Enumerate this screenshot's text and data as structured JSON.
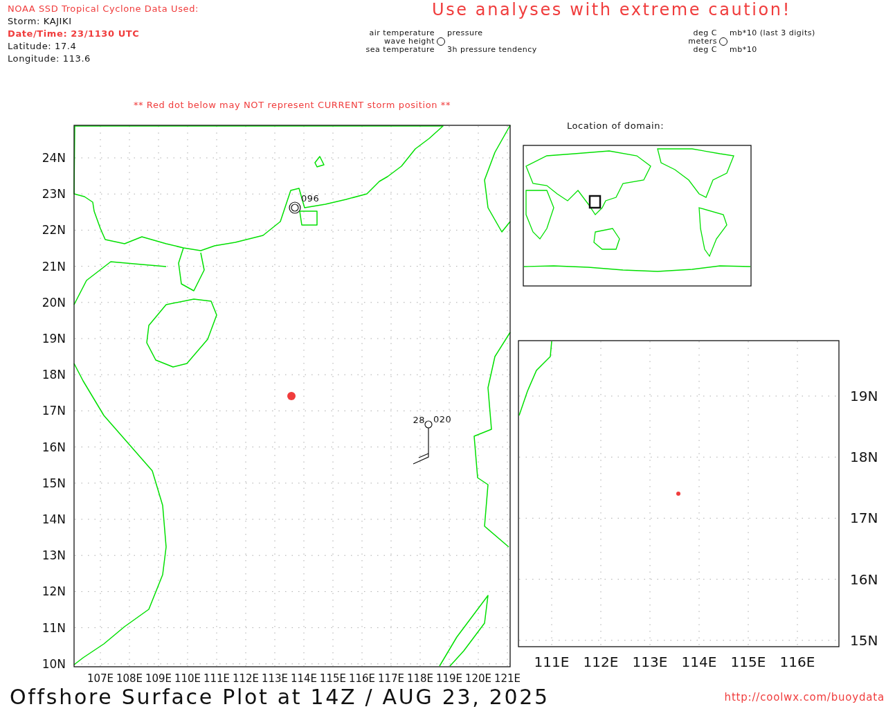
{
  "header": {
    "source_title": "NOAA SSD Tropical Cyclone Data Used:",
    "storm": "Storm: KAJIKI",
    "datetime": "Date/Time: 23/1130 UTC",
    "latitude": "Latitude: 17.4",
    "longitude": "Longitude: 113.6",
    "caution": "Use analyses with extreme caution!"
  },
  "legend": [
    {
      "labels": [
        "air temperature",
        "wave height",
        "sea temperature"
      ],
      "top": "pressure",
      "bottom": "3h pressure tendency"
    },
    {
      "labels": [
        "deg C",
        "meters",
        "deg C"
      ],
      "top": "mb*10 (last 3 digits)",
      "bottom": "mb*10"
    }
  ],
  "notice": "** Red dot below may NOT represent CURRENT storm position **",
  "main_map": {
    "lat_labels": [
      "24N",
      "23N",
      "22N",
      "21N",
      "20N",
      "19N",
      "18N",
      "17N",
      "16N",
      "15N",
      "14N",
      "13N",
      "12N",
      "11N",
      "10N"
    ],
    "lon_labels": [
      "107E",
      "108E",
      "109E",
      "110E",
      "111E",
      "112E",
      "113E",
      "114E",
      "115E",
      "116E",
      "117E",
      "118E",
      "119E",
      "120E",
      "121E"
    ],
    "stations": [
      {
        "kind": "circle",
        "pressure": "096"
      },
      {
        "kind": "barb",
        "air_temp": "28",
        "pressure": "020"
      }
    ]
  },
  "inset": {
    "title": "Location of domain:"
  },
  "zoom_map": {
    "lat_labels": [
      "19N",
      "18N",
      "17N",
      "16N",
      "15N"
    ],
    "lon_labels": [
      "111E",
      "112E",
      "113E",
      "114E",
      "115E",
      "116E"
    ]
  },
  "footer": {
    "title": "Offshore Surface Plot at 14Z / AUG 23, 2025",
    "url": "http://coolwx.com/buoydata"
  }
}
